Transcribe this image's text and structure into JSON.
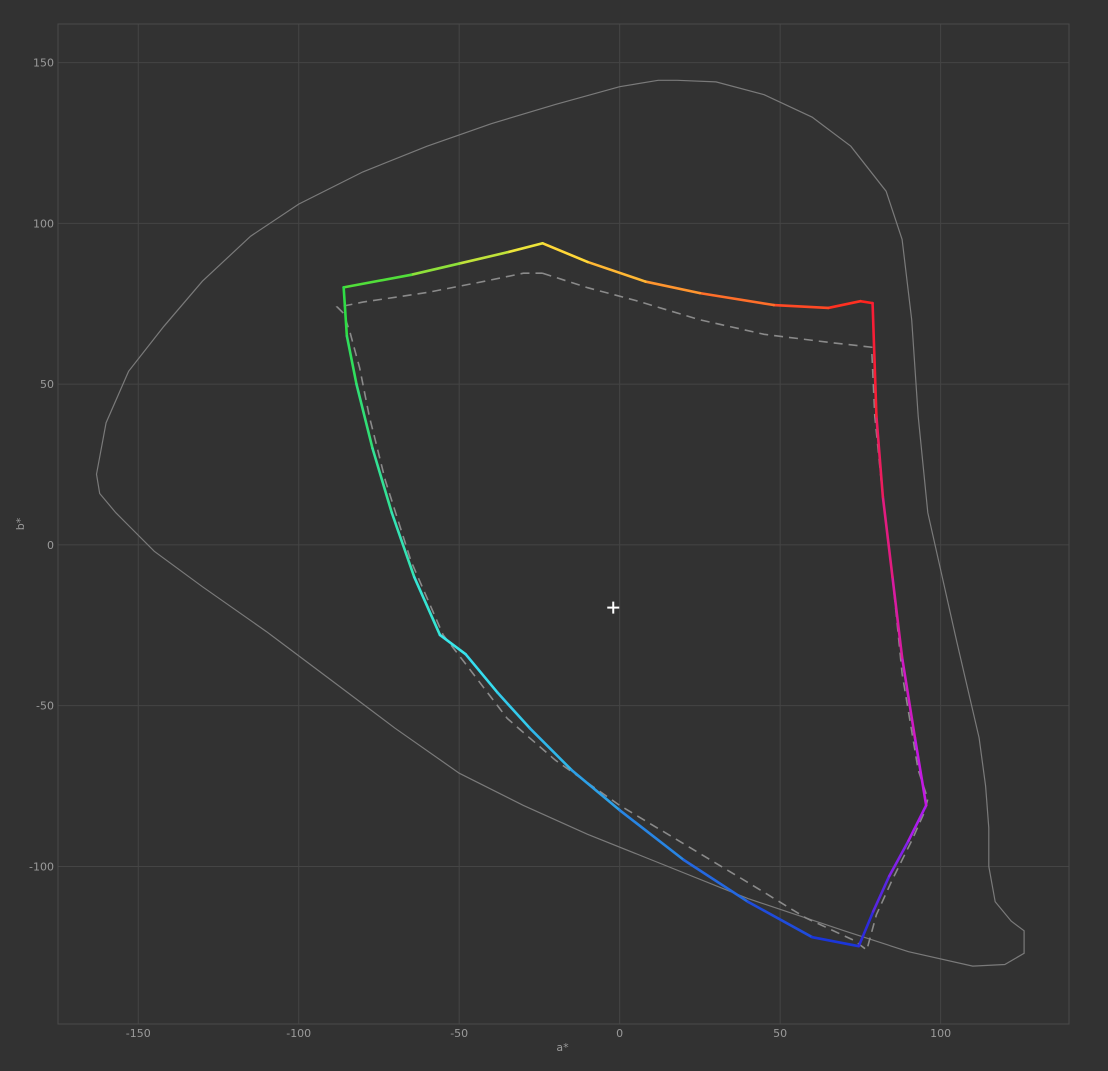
{
  "chart_data": {
    "type": "line",
    "title": "",
    "xlabel": "a*",
    "ylabel": "b*",
    "xlim": [
      -175,
      140
    ],
    "ylim": [
      -149,
      162
    ],
    "xticks": [
      -150,
      -100,
      -50,
      0,
      50,
      100
    ],
    "yticks": [
      150,
      100,
      50,
      0,
      -50,
      -100
    ],
    "grid": true,
    "colors": {
      "background": "#323232",
      "frame": "#4a4a4a",
      "grid": "#454545",
      "spectral_locus": "#7a7a7a",
      "reference_gamut": "#8a8a8a",
      "white_point": "#ffffff"
    },
    "series": [
      {
        "style": "solid-gradient",
        "segments": [
          {
            "from_color": "#ff1f1f",
            "to_color": "#ffe53a",
            "points": [
              [
                78.8,
                75.2
              ],
              [
                75,
                75.8
              ],
              [
                65,
                73.7
              ],
              [
                48,
                74.6
              ],
              [
                25,
                78.3
              ],
              [
                8,
                81.9
              ],
              [
                -10,
                88
              ],
              [
                -24,
                93.8
              ]
            ]
          },
          {
            "from_color": "#ffe53a",
            "to_color": "#2edc3a",
            "points": [
              [
                -24,
                93.8
              ],
              [
                -35,
                91
              ],
              [
                -50,
                87.5
              ],
              [
                -65,
                84
              ],
              [
                -86,
                80.1
              ]
            ]
          },
          {
            "from_color": "#2edc3a",
            "to_color": "#38e6f0",
            "points": [
              [
                -86,
                80.1
              ],
              [
                -85,
                65
              ],
              [
                -82,
                50
              ],
              [
                -77,
                30
              ],
              [
                -71,
                10
              ],
              [
                -64,
                -10
              ],
              [
                -56,
                -28
              ],
              [
                -48,
                -34
              ]
            ]
          },
          {
            "from_color": "#38e6f0",
            "to_color": "#1a2dd8",
            "points": [
              [
                -48,
                -34
              ],
              [
                -38,
                -46
              ],
              [
                -28,
                -57
              ],
              [
                -15,
                -70
              ],
              [
                0,
                -82.5
              ],
              [
                20,
                -98
              ],
              [
                40,
                -111
              ],
              [
                60,
                -122
              ],
              [
                74.5,
                -124.8
              ]
            ]
          },
          {
            "from_color": "#1a2dd8",
            "to_color": "#c019f0",
            "points": [
              [
                74.5,
                -124.8
              ],
              [
                79,
                -114
              ],
              [
                84,
                -103
              ],
              [
                90,
                -92
              ],
              [
                95.5,
                -81
              ]
            ]
          },
          {
            "from_color": "#c019f0",
            "to_color": "#ff1f1f",
            "points": [
              [
                95.5,
                -81
              ],
              [
                92,
                -60
              ],
              [
                88,
                -35
              ],
              [
                85,
                -10
              ],
              [
                82,
                15
              ],
              [
                80,
                40
              ],
              [
                78.8,
                75.2
              ]
            ]
          }
        ]
      },
      {
        "style": "dashed-gray",
        "points": [
          [
            -24,
            84.5
          ],
          [
            -10,
            80
          ],
          [
            5,
            76
          ],
          [
            25,
            70
          ],
          [
            45,
            65.5
          ],
          [
            65,
            63
          ],
          [
            78.5,
            61.5
          ],
          [
            79.5,
            40
          ],
          [
            82,
            15
          ],
          [
            85,
            -10
          ],
          [
            88,
            -40
          ],
          [
            93,
            -70
          ],
          [
            96,
            -79
          ],
          [
            95,
            -83
          ],
          [
            91,
            -92
          ],
          [
            85,
            -104
          ],
          [
            80,
            -115
          ],
          [
            77,
            -126
          ],
          [
            73,
            -123
          ],
          [
            58,
            -116
          ],
          [
            40,
            -105
          ],
          [
            20,
            -93
          ],
          [
            0,
            -81
          ],
          [
            -20,
            -67
          ],
          [
            -35,
            -54
          ],
          [
            -48,
            -37
          ],
          [
            -55,
            -28
          ],
          [
            -65,
            -5
          ],
          [
            -73,
            20
          ],
          [
            -78,
            40
          ],
          [
            -81,
            55
          ],
          [
            -84,
            66
          ],
          [
            -86,
            72
          ],
          [
            -88,
            74
          ],
          [
            -86,
            74.3
          ],
          [
            -80,
            75.5
          ],
          [
            -60,
            78.5
          ],
          [
            -42,
            82
          ],
          [
            -30,
            84.5
          ],
          [
            -24,
            84.5
          ]
        ]
      },
      {
        "style": "spectral-locus",
        "points": [
          [
            18,
            144.5
          ],
          [
            12,
            144.5
          ],
          [
            0,
            142.5
          ],
          [
            -20,
            137
          ],
          [
            -40,
            131
          ],
          [
            -60,
            124
          ],
          [
            -80,
            116
          ],
          [
            -100,
            106
          ],
          [
            -115,
            96
          ],
          [
            -130,
            82
          ],
          [
            -142,
            68
          ],
          [
            -153,
            54
          ],
          [
            -160,
            38
          ],
          [
            -163,
            22
          ],
          [
            -162,
            16
          ],
          [
            -157,
            10
          ],
          [
            -145,
            -2
          ],
          [
            -130,
            -13
          ],
          [
            -110,
            -27
          ],
          [
            -90,
            -42
          ],
          [
            -70,
            -57
          ],
          [
            -50,
            -71
          ],
          [
            -30,
            -81
          ],
          [
            -10,
            -90
          ],
          [
            10,
            -98
          ],
          [
            40,
            -110
          ],
          [
            70,
            -120
          ],
          [
            90,
            -126.5
          ],
          [
            110,
            -131
          ],
          [
            120,
            -130.5
          ],
          [
            126,
            -127
          ],
          [
            126,
            -120
          ],
          [
            122,
            -117
          ],
          [
            117,
            -111
          ],
          [
            115,
            -100
          ],
          [
            115,
            -88
          ],
          [
            114,
            -75
          ],
          [
            112,
            -60
          ],
          [
            105,
            -30
          ],
          [
            96,
            10
          ],
          [
            93,
            40
          ],
          [
            91,
            70
          ],
          [
            88,
            95
          ],
          [
            83,
            110
          ],
          [
            72,
            124
          ],
          [
            60,
            133
          ],
          [
            45,
            140
          ],
          [
            30,
            144
          ],
          [
            18,
            144.5
          ]
        ]
      }
    ],
    "white_point": [
      -2,
      -19.5
    ]
  }
}
